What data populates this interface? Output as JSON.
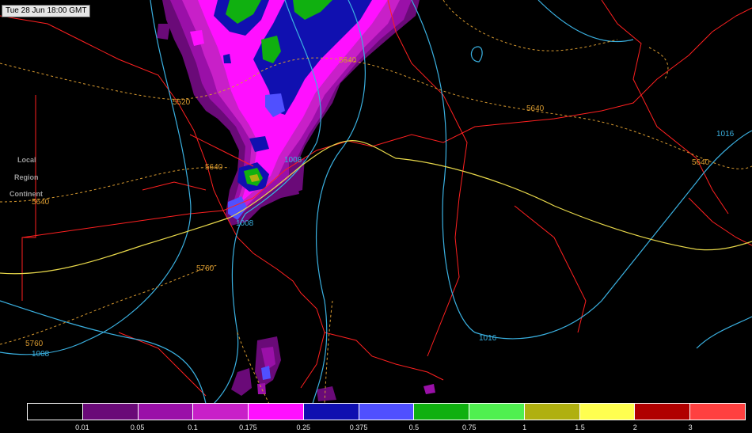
{
  "header": {
    "timestamp": "Tue 28 Jun 18:00 GMT"
  },
  "zoom_controls": [
    "Local",
    "Region",
    "Continent"
  ],
  "contour_labels": {
    "isobars": [
      "1008",
      "1008",
      "1008",
      "1016",
      "1016"
    ],
    "thickness": [
      "5640",
      "5520",
      "5640",
      "5640",
      "5640",
      "5640",
      "5760",
      "5760"
    ]
  },
  "colors": {
    "background": "#000000",
    "border_lines": "#ff2020",
    "isobars": "#3ab0e0",
    "thickness_dashed": "#d89a30",
    "thickness_solid": "#e8d84a"
  },
  "legend": {
    "swatches": [
      "#000000",
      "#6a0a78",
      "#9a10a8",
      "#c820c8",
      "#ff10ff",
      "#1010b0",
      "#5050ff",
      "#10b010",
      "#50f050",
      "#b0b010",
      "#ffff50",
      "#b00000",
      "#ff4040"
    ],
    "tick_labels": [
      "0.01",
      "0.05",
      "0.1",
      "0.175",
      "0.25",
      "0.375",
      "0.5",
      "0.75",
      "1",
      "1.5",
      "2",
      "3"
    ]
  }
}
